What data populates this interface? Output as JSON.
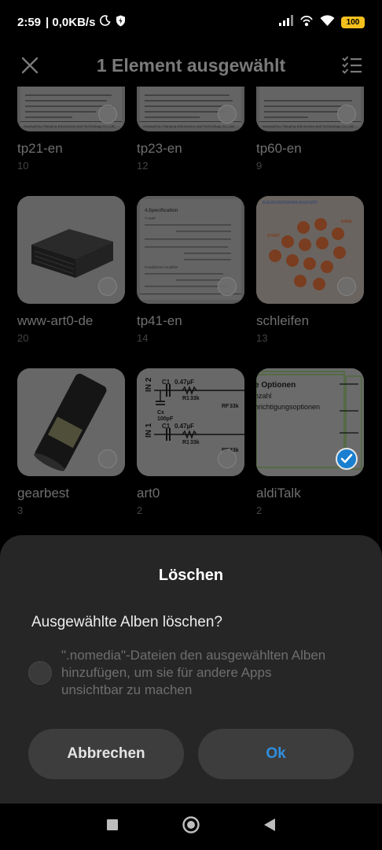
{
  "status_bar": {
    "time": "2:59",
    "network_speed": "| 0,0KB/s",
    "battery_level": "100",
    "icons": [
      "moon-icon",
      "shield-icon",
      "signal-icon",
      "hotspot-icon",
      "wifi-icon",
      "battery-icon"
    ]
  },
  "topbar": {
    "title": "1 Element ausgewählt",
    "close_icon": "close-icon",
    "select_all_icon": "checklist-icon"
  },
  "albums": [
    {
      "name": "tp21-en",
      "count": "10",
      "selected": false
    },
    {
      "name": "tp23-en",
      "count": "12",
      "selected": false
    },
    {
      "name": "tp60-en",
      "count": "9",
      "selected": false
    },
    {
      "name": "www-art0-de",
      "count": "20",
      "selected": false
    },
    {
      "name": "tp41-en",
      "count": "14",
      "selected": false
    },
    {
      "name": "schleifen",
      "count": "13",
      "selected": false
    },
    {
      "name": "gearbest",
      "count": "3",
      "selected": false
    },
    {
      "name": "art0",
      "count": "2",
      "selected": false
    },
    {
      "name": "aldiTalk",
      "count": "2",
      "selected": true
    }
  ],
  "thumb_text": {
    "tp21": "Guangzhou Tianping Electronics and Technology Co.,Ltd.",
    "tp23": "Guangzhou Tianping Electronics and Technology Co.,Ltd.",
    "tp60": "Guangzhou Tianping Electronics and Technology Co.,Ltd.",
    "tp41_heading": "4.Specification",
    "tp41_amp": "T-AMP",
    "tp41_headphone": "Headphone Amplifier",
    "schleifen_heading": "BEI WELCHER SCHLEIFSTEINKÖRNUNG MACHE ICH WEITER?",
    "schleifen_start": "START",
    "schleifen_ende": "ENDE",
    "art0_in2": "IN 2",
    "art0_in1": "IN 1",
    "art0_c1": "C1",
    "art0_c1_val": "0.47µF",
    "art0_cx": "Cx",
    "art0_cx_val": "100pF",
    "art0_r1": "R1",
    "art0_r1_val": "33k",
    "art0_rf": "RF",
    "art0_rf_val": "33k",
    "alditalk_line1": "e Optionen",
    "alditalk_line2": "nzahl",
    "alditalk_line3": "hrichtigungsoptionen"
  },
  "dialog": {
    "title": "Löschen",
    "question": "Ausgewählte Alben löschen?",
    "option_label": "\".nomedia\"-Dateien den ausgewählten Alben hinzufügen, um sie für andere Apps unsichtbar zu machen",
    "option_checked": false,
    "cancel_label": "Abbrechen",
    "ok_label": "Ok"
  },
  "navbar": {
    "icons": [
      "recents-icon",
      "home-icon",
      "back-icon"
    ]
  },
  "colors": {
    "accent": "#2f8fe0",
    "selected_check": "#1a7fd0",
    "battery": "#f4c01e",
    "sheet_bg": "#262626",
    "button_bg": "#3d3d3d"
  }
}
